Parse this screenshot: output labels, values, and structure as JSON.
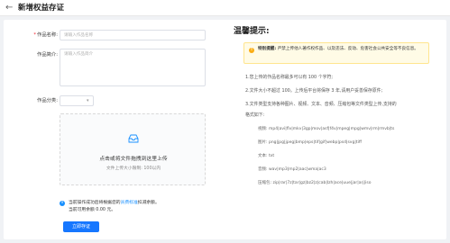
{
  "header": {
    "back_icon": "back-arrow-icon",
    "title": "新增权益存证"
  },
  "form": {
    "name": {
      "required_mark": "*",
      "label": "作品名称:",
      "placeholder": "请输入作品名称"
    },
    "intro": {
      "label": "作品简介:",
      "placeholder": "请输入作品简介"
    },
    "category": {
      "label": "作品分类:",
      "value": ""
    },
    "upload": {
      "icon": "inbox-icon",
      "title": "点击或将文件拖拽到这里上传",
      "subtitle": "文件上传大小限制: 100以内"
    },
    "notice": {
      "icon": "info-icon",
      "line1_prefix": "当前操作成功后将根据您的",
      "line1_link": "员费标准",
      "line1_suffix": "扣减余额。",
      "line2": "当前可用余额 0.00 元。"
    },
    "submit_label": "立即存证"
  },
  "tips": {
    "title": "温馨提示:",
    "warning": {
      "icon": "warning-icon",
      "text_bold": "特别提醒:",
      "text": "严禁上传他人著作权作品、以及违法、反动、危害社会公共安全等不良信息。"
    },
    "items": [
      "1.您上传的作品名称最多可以有 100 个字符;",
      "2.文件大小不超过 100。上传后平台将保存 3 年,请用户妥善保存原件;",
      "3.文件类型支持各种图片、视频、文本、音频、压缩包等文件类型上传,支持的",
      "格式如下:"
    ],
    "formats": [
      {
        "label": "视频:",
        "value": "mp4|avi|flv|mkv|3gp|mov|asf|f4v|mpeg|mpg|wmv|rm|rmvb|ts"
      },
      {
        "label": "图片:",
        "value": "png|jpg|jpeg|bmp|eps|tif|gif|webp|psd|svg|tiff"
      },
      {
        "label": "文本:",
        "value": "txt"
      },
      {
        "label": "音频:",
        "value": "wav|mp3|mp2|aac|wma|ac3"
      },
      {
        "label": "压缩包:",
        "value": "zip|rar|7z|tar|gz|bz2|z|cab|lzh|ace|uue|jar|arj|iso"
      }
    ]
  }
}
